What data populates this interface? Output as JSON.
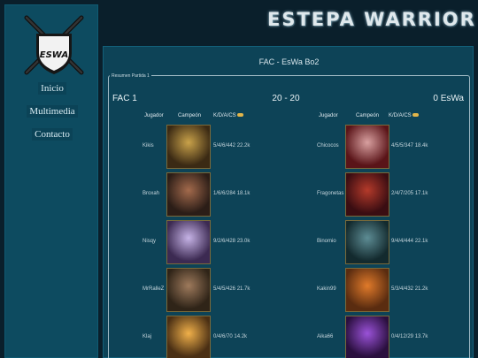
{
  "site": {
    "title": "ESTEPA WARRIOR",
    "logo_text": "ESWA"
  },
  "nav": [
    {
      "label": "Inicio"
    },
    {
      "label": "Multimedia"
    },
    {
      "label": "Contacto"
    }
  ],
  "match": {
    "title": "FAC - EsWa Bo2",
    "legend": "Resumen Partida 1",
    "team_left": "FAC 1",
    "score": "20 - 20",
    "team_right": "0 EsWa",
    "headers": {
      "player": "Jugador",
      "champion": "Campeón",
      "kda": "K/D/A/CS"
    },
    "left": [
      {
        "player": "Kikis",
        "stats": "5/4/6/442 22.2k",
        "champ_colors": [
          "#3b2a14",
          "#c9a24a"
        ]
      },
      {
        "player": "Broxah",
        "stats": "1/6/6/284 18.1k",
        "champ_colors": [
          "#2b1d17",
          "#a36a4c"
        ]
      },
      {
        "player": "Nisqy",
        "stats": "9/2/6/428 23.0k",
        "champ_colors": [
          "#3c2a52",
          "#c6b3e6"
        ]
      },
      {
        "player": "MrRalleZ",
        "stats": "5/4/5/426 21.7k",
        "champ_colors": [
          "#2f2418",
          "#9e7a5c"
        ]
      },
      {
        "player": "Klaj",
        "stats": "0/4/6/70  14.2k",
        "champ_colors": [
          "#4a2f14",
          "#f0b04a"
        ]
      }
    ],
    "right": [
      {
        "player": "Chicocos",
        "stats": "4/5/5/347 18.4k",
        "champ_colors": [
          "#5a1418",
          "#d8a0a0"
        ]
      },
      {
        "player": "Fragonetas",
        "stats": "2/4/7/205 17.1k",
        "champ_colors": [
          "#3a0d12",
          "#b43a2a"
        ]
      },
      {
        "player": "Binomio",
        "stats": "9/4/4/444 22.1k",
        "champ_colors": [
          "#132a2e",
          "#5d8c94"
        ]
      },
      {
        "player": "Kakin99",
        "stats": "5/3/4/432 21.2k",
        "champ_colors": [
          "#5a2c10",
          "#e07a2a"
        ]
      },
      {
        "player": "Aika66",
        "stats": "0/4/12/29 13.7k",
        "champ_colors": [
          "#2a0f3e",
          "#9a52d8"
        ]
      }
    ]
  }
}
